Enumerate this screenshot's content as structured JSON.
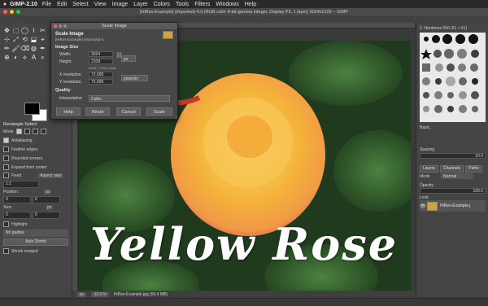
{
  "menubar": {
    "app_name": "GIMP-2.10",
    "items": [
      "File",
      "Edit",
      "Select",
      "View",
      "Image",
      "Layer",
      "Colors",
      "Tools",
      "Filters",
      "Windows",
      "Help"
    ]
  },
  "window_title": "[HiRes-Example] (imported)-4.0 (RGB color 8-bit gamma integer, Display P3, 1 layer) 3024x2109 – GIMP",
  "toolbox": {
    "tool_icons": [
      "✥",
      "⬚",
      "◯",
      "⌇",
      "✂",
      "⊹",
      "⤢",
      "⟲",
      "⬓",
      "⌖",
      "✏",
      "🖌",
      "⌫",
      "◍",
      "✒",
      "⊕",
      "◐",
      "⟡",
      "A",
      "⌕"
    ],
    "options_title": "Rectangle Select",
    "mode_label": "Mode",
    "antialiasing": "Antialiasing",
    "feather_edges": "Feather edges",
    "rounded_corners": "Rounded corners",
    "expand_from_center": "Expand from center",
    "fixed_label": "Fixed",
    "fixed_value": "Aspect ratio",
    "ratio_value": "1:1",
    "position_label": "Position:",
    "position_unit": "px",
    "position_x": "0",
    "position_y": "0",
    "size_label": "Size:",
    "size_unit": "px",
    "size_x": "0",
    "size_y": "0",
    "highlight": "Highlight",
    "guides": "No guides",
    "auto_shrink": "Auto Shrink",
    "shrink_merged": "Shrink merged"
  },
  "dialog": {
    "window_title": "Scale Image",
    "heading": "Scale Image",
    "subheading": "[HiRes-Example] (imported)-4",
    "image_size_label": "Image Size",
    "width_label": "Width:",
    "width_value": "3024",
    "height_label": "Height:",
    "height_value": "2109",
    "size_unit": "px",
    "pixels_info": "3024 × 2109 pixels",
    "xres_label": "X resolution:",
    "xres_value": "72.000",
    "yres_label": "Y resolution:",
    "yres_value": "72.000",
    "res_unit": "pixels/in",
    "quality_label": "Quality",
    "interp_label": "Interpolation:",
    "interp_value": "Cubic",
    "buttons": [
      "Help",
      "Reset",
      "Cancel",
      "Scale"
    ]
  },
  "canvas": {
    "overlay_text": "Yellow Rose"
  },
  "statusbar": {
    "unit": "px",
    "zoom": "33.3 %",
    "file_info": "HiRes-Example.jpg (59.4 MB)"
  },
  "dock": {
    "brush_name": "2. Hardness 050 (51 × 51)",
    "brush_category": "Basic,",
    "spacing_label": "Spacing",
    "spacing_value": "10.0",
    "tabs": [
      "Layers",
      "Channels",
      "Paths"
    ],
    "mode_label": "Mode",
    "mode_value": "Normal",
    "opacity_label": "Opacity",
    "opacity_value": "100.0",
    "lock_label": "Lock:",
    "layer_name": "HiRes-Example.j"
  },
  "colors": {
    "accent_arrow": "#c0392b",
    "rose_core": "#f4b43a",
    "rose_edge": "#e5586a",
    "foliage": "#2f5a2a"
  }
}
